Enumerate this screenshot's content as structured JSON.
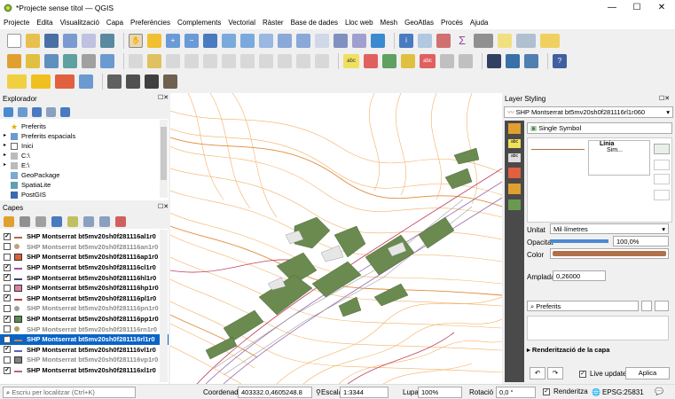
{
  "window": {
    "title": "*Projecte sense títol — QGIS",
    "minimize": "—",
    "maximize": "☐",
    "close": "✕"
  },
  "menu": [
    "Projecte",
    "Edita",
    "Visualització",
    "Capa",
    "Preferències",
    "Complements",
    "Vectorial",
    "Ràster",
    "Base de dades",
    "Lloc web",
    "Mesh",
    "GeoAtlas",
    "Procés",
    "Ajuda"
  ],
  "browser": {
    "title": "Explorador",
    "items": [
      {
        "label": "Preferits",
        "icon": "star-icon"
      },
      {
        "label": "Preferits espacials",
        "icon": "spatial-bookmark-icon"
      },
      {
        "label": "Inici",
        "icon": "home-icon"
      },
      {
        "label": "C:\\",
        "icon": "drive-icon"
      },
      {
        "label": "E:\\",
        "icon": "drive-icon"
      },
      {
        "label": "GeoPackage",
        "icon": "geopackage-icon"
      },
      {
        "label": "SpatiaLite",
        "icon": "spatialite-icon"
      },
      {
        "label": "PostGIS",
        "icon": "postgis-icon"
      }
    ]
  },
  "layers": {
    "title": "Capes",
    "items": [
      {
        "label": "SHP Montserrat bt5mv20sh0f281116al1r0",
        "checked": true,
        "symbol": "line",
        "color": "#b06a4a",
        "grey": false
      },
      {
        "label": "SHP Montserrat bt5mv20sh0f281116an1r0",
        "checked": false,
        "symbol": "point",
        "color": "#c0a080",
        "grey": true
      },
      {
        "label": "SHP Montserrat bt5mv20sh0f281116ap1r0",
        "checked": false,
        "symbol": "fill",
        "color": "#e06030",
        "grey": false
      },
      {
        "label": "SHP Montserrat bt5mv20sh0f281116cl1r0",
        "checked": true,
        "symbol": "line",
        "color": "#a050a0",
        "grey": false
      },
      {
        "label": "SHP Montserrat bt5mv20sh0f281116hl1r0",
        "checked": true,
        "symbol": "line",
        "color": "#404080",
        "grey": false
      },
      {
        "label": "SHP Montserrat bt5mv20sh0f281116hp1r0",
        "checked": false,
        "symbol": "fill",
        "color": "#e080a0",
        "grey": false
      },
      {
        "label": "SHP Montserrat bt5mv20sh0f281116pl1r0",
        "checked": true,
        "symbol": "line",
        "color": "#b04040",
        "grey": false
      },
      {
        "label": "SHP Montserrat bt5mv20sh0f281116pn1r0",
        "checked": false,
        "symbol": "point",
        "color": "#a0a0a0",
        "grey": true
      },
      {
        "label": "SHP Montserrat bt5mv20sh0f281116pp1r0",
        "checked": true,
        "symbol": "fill",
        "color": "#5a8a50",
        "grey": false
      },
      {
        "label": "SHP Montserrat bt5mv20sh0f281116rn1r0",
        "checked": false,
        "symbol": "point",
        "color": "#b0a060",
        "grey": true
      },
      {
        "label": "SHP Montserrat bt5mv20sh0f281116rl1r0",
        "checked": true,
        "symbol": "line",
        "color": "#d08040",
        "grey": false,
        "selected": true
      },
      {
        "label": "SHP Montserrat bt5mv20sh0f281116vl1r0",
        "checked": true,
        "symbol": "line",
        "color": "#6060c0",
        "grey": false
      },
      {
        "label": "SHP Montserrat bt5mv20sh0f281116vp1r0",
        "checked": false,
        "symbol": "fill",
        "color": "#808080",
        "grey": true
      },
      {
        "label": "SHP Montserrat bt5mv20sh0f281116xl1r0",
        "checked": true,
        "symbol": "line",
        "color": "#c06080",
        "grey": false
      }
    ]
  },
  "styling": {
    "title": "Layer Styling",
    "layer": "SHP Montserrat bt5mv20sh0f281116rl1r060",
    "renderer": "Single Symbol",
    "tree": [
      "Línia",
      "Sim..."
    ],
    "unit_label": "Unitat",
    "unit_value": "Mil·límetres",
    "opacity_label": "Opacitat",
    "opacity_value": "100,0%",
    "opacity": 1.0,
    "color_label": "Color",
    "color_value": "#b0704a",
    "width_label": "Amplada",
    "width_value": "0,26000",
    "library_filter": "Preferits",
    "render_section": "Renderització de la capa",
    "live_update": "Live update",
    "apply": "Aplica"
  },
  "status": {
    "search_placeholder": "Escriu per localitzar (Ctrl+K)",
    "coord_label": "Coordenada",
    "coord_value": "403332.0,4605248.8",
    "scale_label": "Escala",
    "scale_value": "1:3344",
    "magnifier_label": "Lupa",
    "magnifier_value": "100%",
    "rotation_label": "Rotació",
    "rotation_value": "0,0 °",
    "render_label": "Renderitza",
    "crs": "EPSG:25831"
  }
}
